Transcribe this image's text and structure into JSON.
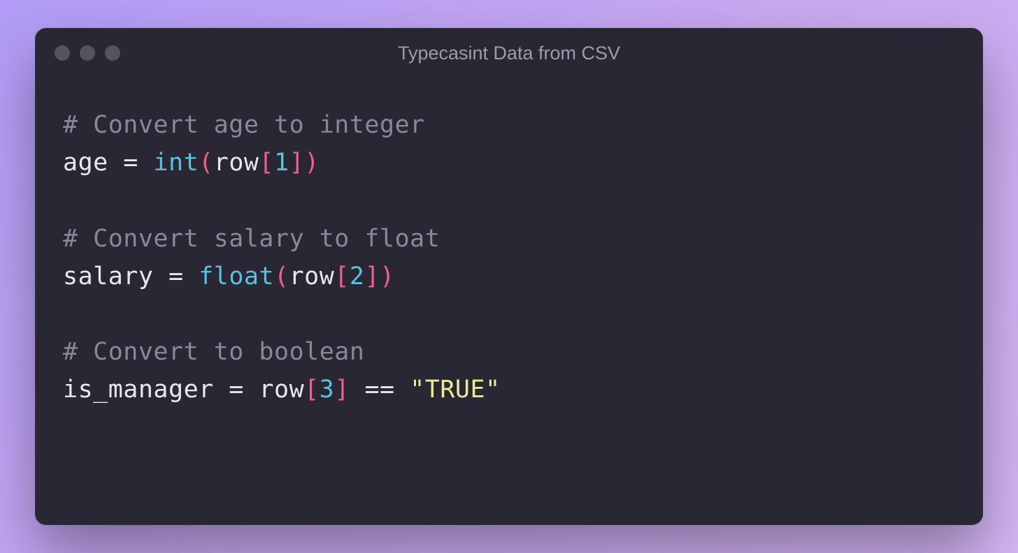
{
  "window": {
    "title": "Typecasint Data from CSV"
  },
  "code": {
    "line1_comment": "# Convert age to integer",
    "line2": {
      "var": "age",
      "sp1": " ",
      "eq": "=",
      "sp2": " ",
      "fn": "int",
      "lp": "(",
      "arg": "row",
      "lb": "[",
      "idx": "1",
      "rb": "]",
      "rp": ")"
    },
    "line3_comment": "# Convert salary to float",
    "line4": {
      "var": "salary",
      "sp1": " ",
      "eq": "=",
      "sp2": " ",
      "fn": "float",
      "lp": "(",
      "arg": "row",
      "lb": "[",
      "idx": "2",
      "rb": "]",
      "rp": ")"
    },
    "line5_comment": "# Convert to boolean",
    "line6": {
      "var": "is_manager",
      "sp1": " ",
      "eq": "=",
      "sp2": " ",
      "arg": "row",
      "lb": "[",
      "idx": "3",
      "rb": "]",
      "sp3": " ",
      "cmp": "==",
      "sp4": " ",
      "str": "\"TRUE\""
    }
  }
}
